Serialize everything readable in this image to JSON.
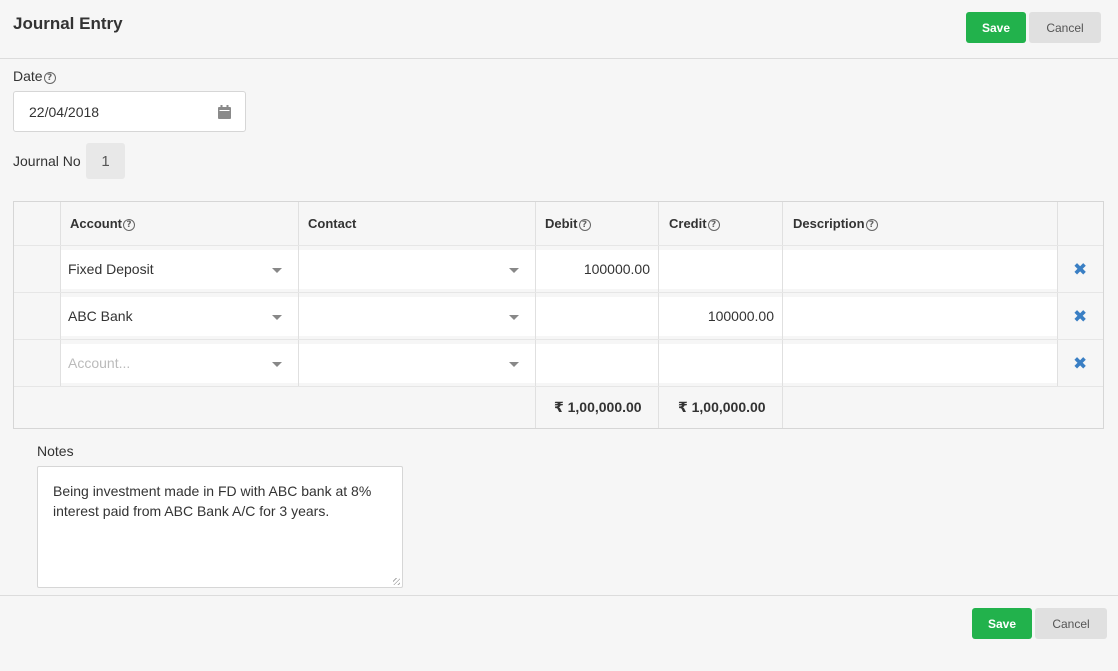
{
  "header": {
    "title": "Journal Entry",
    "save_label": "Save",
    "cancel_label": "Cancel"
  },
  "form": {
    "date_label": "Date",
    "date_value": "22/04/2018",
    "journal_no_label": "Journal No",
    "journal_no_value": "1"
  },
  "table": {
    "columns": [
      "Account",
      "Contact",
      "Debit",
      "Credit",
      "Description"
    ],
    "rows": [
      {
        "account": "Fixed Deposit",
        "contact": "",
        "debit": "100000.00",
        "credit": "",
        "description": ""
      },
      {
        "account": "ABC Bank",
        "contact": "",
        "debit": "",
        "credit": "100000.00",
        "description": ""
      },
      {
        "account": "",
        "contact": "",
        "debit": "",
        "credit": "",
        "description": ""
      }
    ],
    "account_placeholder": "Account...",
    "total_debit": "₹ 1,00,000.00",
    "total_credit": "₹ 1,00,000.00"
  },
  "notes": {
    "label": "Notes",
    "text": "Being investment made in FD with ABC bank at 8% interest paid from ABC Bank A/C for 3 years."
  },
  "footer": {
    "save_label": "Save",
    "cancel_label": "Cancel"
  },
  "colors": {
    "save": "#22b24c",
    "remove_icon": "#3a7fc4"
  },
  "icons": {
    "help": "question-circle-icon",
    "calendar": "calendar-icon",
    "remove": "close-icon",
    "dropdown": "chevron-down-icon"
  }
}
